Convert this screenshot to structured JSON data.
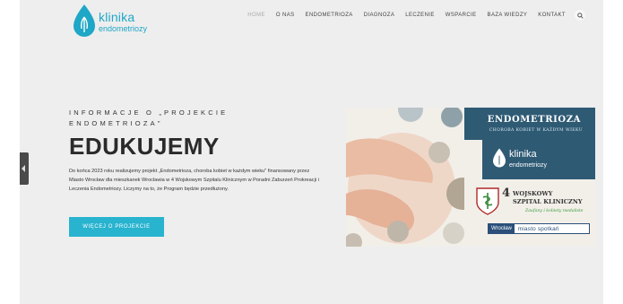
{
  "logo": {
    "line1": "klinika",
    "line2": "endometriozy"
  },
  "nav": {
    "items": [
      {
        "label": "HOME",
        "active": true
      },
      {
        "label": "O NAS",
        "active": false
      },
      {
        "label": "ENDOMETRIOZA",
        "active": false
      },
      {
        "label": "DIAGNOZA",
        "active": false
      },
      {
        "label": "LECZENIE",
        "active": false
      },
      {
        "label": "WSPARCIE",
        "active": false
      },
      {
        "label": "BAZA WIEDZY",
        "active": false
      },
      {
        "label": "KONTAKT",
        "active": false
      }
    ],
    "search_icon": "search-icon"
  },
  "hero": {
    "eyebrow": "INFORMACJE O „PROJEKCIE ENDOMETRIOZA\"",
    "headline": "EDUKUJEMY",
    "body": "Do końca 2023 roku realizujemy projekt „Endometrioza, choroba kobiet w każdym wieku\" finansowany przez Miasto Wrocław dla mieszkanek Wrocławia w 4 Wojskowym Szpitalu Klinicznym w Poradni Zaburzeń Prokreacji i Leczenia Endometriozy. Liczymy na to, że Program będzie przedłużony.",
    "cta": "WIĘCEJ O PROJEKCIE"
  },
  "banner": {
    "title": "ENDOMETRIOZA",
    "subtitle": "CHOROBA KOBIET W KAŻDYM WIEKU",
    "logo_line1": "klinika",
    "logo_line2": "endometriozy",
    "hospital_number": "4",
    "hospital_line1": "WOJSKOWY",
    "hospital_line2": "SZPITAL KLINICZNY",
    "hospital_motto": "Zaufany i kobiety medaliste",
    "city_a": "Wrocław",
    "city_b": "miasto spotkań"
  },
  "colors": {
    "accent": "#28b3cf",
    "banner_blue": "#2e5a74",
    "background": "#eeeeee"
  }
}
